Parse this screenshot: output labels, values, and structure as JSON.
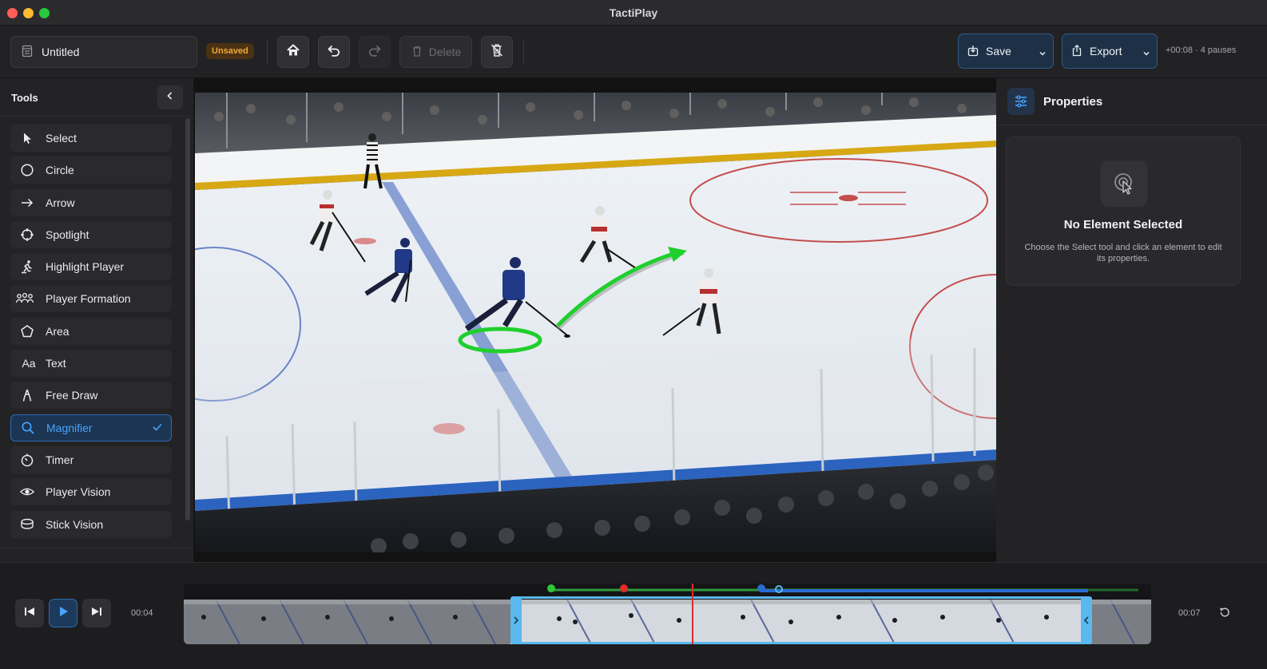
{
  "app": {
    "title": "TactiPlay"
  },
  "toolbar": {
    "project_name": "Untitled",
    "unsaved_label": "Unsaved",
    "delete_label": "Delete",
    "save_label": "Save",
    "export_label": "Export",
    "stats": "+00:08 · 4 pauses"
  },
  "sidebar": {
    "title": "Tools",
    "items": [
      {
        "label": "Select",
        "icon": "cursor-icon"
      },
      {
        "label": "Circle",
        "icon": "circle-icon"
      },
      {
        "label": "Arrow",
        "icon": "arrow-right-icon"
      },
      {
        "label": "Spotlight",
        "icon": "crosshair-icon"
      },
      {
        "label": "Highlight Player",
        "icon": "skater-icon"
      },
      {
        "label": "Player Formation",
        "icon": "group-icon"
      },
      {
        "label": "Area",
        "icon": "pentagon-icon"
      },
      {
        "label": "Text",
        "icon": "text-icon"
      },
      {
        "label": "Free Draw",
        "icon": "pen-icon"
      },
      {
        "label": "Magnifier",
        "icon": "magnifier-icon",
        "active": true
      },
      {
        "label": "Timer",
        "icon": "timer-icon"
      },
      {
        "label": "Player Vision",
        "icon": "eye-icon"
      },
      {
        "label": "Stick Vision",
        "icon": "stick-icon"
      }
    ]
  },
  "properties": {
    "title": "Properties",
    "empty_title": "No Element Selected",
    "empty_desc": "Choose the Select tool and click an element to edit its properties."
  },
  "timeline": {
    "current_time": "00:04",
    "end_time": "00:07"
  },
  "colors": {
    "accent": "#4aa3ff",
    "selection": "#5ab8ee",
    "annotation_green": "#1fd02c",
    "playhead": "#e02c2c",
    "unsaved": "#f0a93a"
  }
}
